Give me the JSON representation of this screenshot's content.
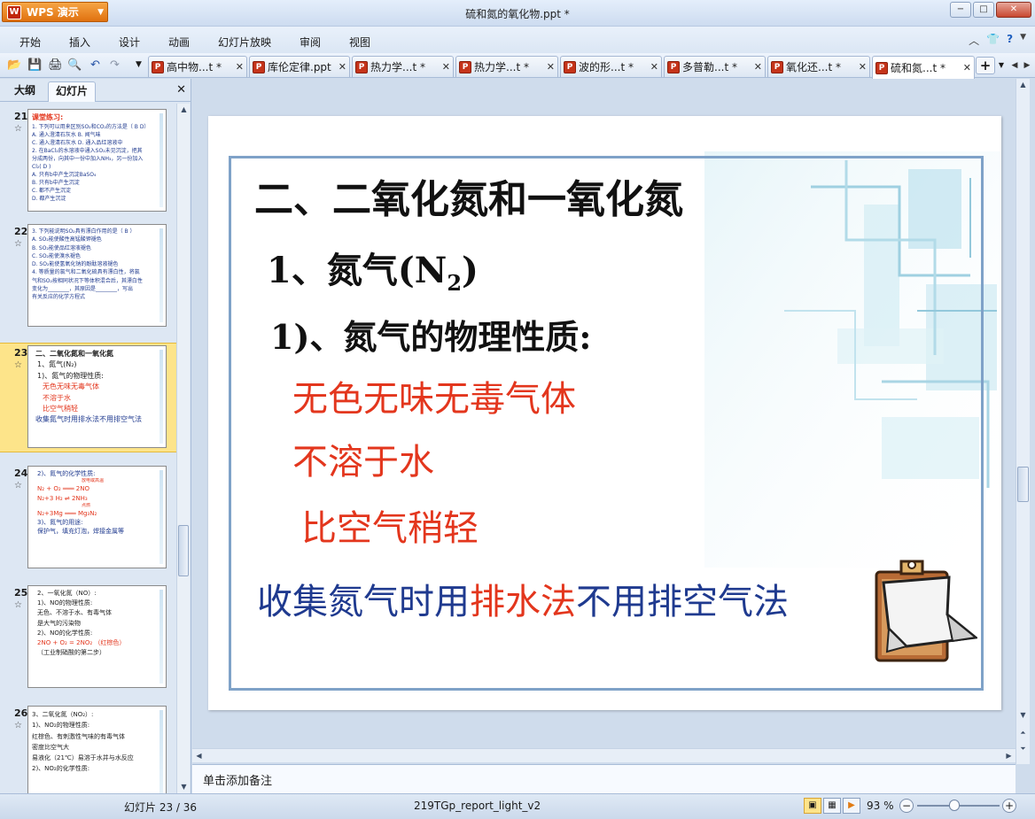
{
  "app": {
    "button_label": "WPS 演示",
    "window_title": "硫和氮的氧化物.ppt *",
    "controls": {
      "minimize": "−",
      "restore": "□",
      "close": "✕"
    }
  },
  "menu": {
    "items": [
      "开始",
      "插入",
      "设计",
      "动画",
      "幻灯片放映",
      "审阅",
      "视图"
    ],
    "right_icons": [
      "chevron-up-icon",
      "shirt-skin-icon",
      "help-icon"
    ]
  },
  "toolbar": {
    "icons": [
      "open-folder-icon",
      "save-icon",
      "print-icon",
      "print-preview-icon",
      "undo-icon",
      "redo-icon",
      "more-icon"
    ]
  },
  "doc_tabs": [
    {
      "label": "高中物...t *",
      "active": false
    },
    {
      "label": "库伦定律.ppt",
      "active": false
    },
    {
      "label": "热力学...t *",
      "active": false
    },
    {
      "label": "热力学...t *",
      "active": false
    },
    {
      "label": "波的形...t *",
      "active": false
    },
    {
      "label": "多普勒...t *",
      "active": false
    },
    {
      "label": "氧化还...t *",
      "active": false
    },
    {
      "label": "硫和氮...t *",
      "active": true
    }
  ],
  "side_pane": {
    "tabs": [
      "大纲",
      "幻灯片"
    ],
    "active_tab": "幻灯片",
    "close": "✕",
    "thumbnails": [
      {
        "number": "21",
        "lines": [
          {
            "text": "课堂练习:",
            "color": "red"
          },
          {
            "text": "1. 下列可以用来区别SO₂和CO₂的方法是（ B D）",
            "color": "blue"
          },
          {
            "text": "A. 通入澄清石灰水  B. 闻气味",
            "color": "blue"
          },
          {
            "text": "C. 通入澄清石灰水  D. 通入品红溶液中",
            "color": "blue"
          },
          {
            "text": "2. 在BaCl₂的水溶液中通入SO₂未见沉淀，把其",
            "color": "blue"
          },
          {
            "text": "分成两份，向其中一份中加入NH₃，另一份加入",
            "color": "blue"
          },
          {
            "text": "Cl₂( D )",
            "color": "blue"
          },
          {
            "text": "A. 只有b中产生沉淀BaSO₄",
            "color": "blue"
          },
          {
            "text": "B. 只有b中产生沉淀",
            "color": "blue"
          },
          {
            "text": "C. 都不产生沉淀",
            "color": "blue"
          },
          {
            "text": "D. 都产生沉淀",
            "color": "blue"
          }
        ]
      },
      {
        "number": "22",
        "lines": [
          {
            "text": "3. 下列能说明SO₂具有漂白作用的是（ B ）",
            "color": "blue"
          },
          {
            "text": "A. SO₂能使酸性高锰酸钾褪色",
            "color": "blue"
          },
          {
            "text": "B. SO₂能使品红溶液褪色",
            "color": "blue"
          },
          {
            "text": "C. SO₂能使溴水褪色",
            "color": "blue"
          },
          {
            "text": "D. SO₂能使氢氧化钠的酚酞溶液褪色",
            "color": "blue"
          },
          {
            "text": "4. 等质量的氯气和二氧化硫具有漂白性，将氯",
            "color": "blue"
          },
          {
            "text": "气和SO₂按相同状况下等体积混合后，其漂白性",
            "color": "blue"
          },
          {
            "text": "变化为________，其原因是________，写出",
            "color": "blue"
          },
          {
            "text": "有关反应的化学方程式",
            "color": "blue"
          }
        ]
      },
      {
        "number": "23",
        "selected": true,
        "lines": [
          {
            "text": "二、二氧化氮和一氧化氮",
            "color": "dark"
          },
          {
            "text": "1、氮气(N₂)",
            "color": "dark"
          },
          {
            "text": "1)、氮气的物理性质:",
            "color": "dark"
          },
          {
            "text": "无色无味无毒气体",
            "color": "red"
          },
          {
            "text": "不溶于水",
            "color": "red"
          },
          {
            "text": "比空气稍轻",
            "color": "red"
          },
          {
            "text": "收集氮气时用排水法不用排空气法",
            "color": "blue"
          }
        ]
      },
      {
        "number": "24",
        "lines": [
          {
            "text": "2)、氮气的化学性质:",
            "color": "blue"
          },
          {
            "text": "放电或高温",
            "color": "red"
          },
          {
            "text": "N₂ + O₂  ═══  2NO",
            "color": "red"
          },
          {
            "text": "N₂+3 H₂  ⇌  2NH₃",
            "color": "red"
          },
          {
            "text": "点燃",
            "color": "red"
          },
          {
            "text": "N₂+3Mg ═══ Mg₃N₂",
            "color": "red"
          },
          {
            "text": "3)、氮气的用途:",
            "color": "blue"
          },
          {
            "text": "保护气，填充灯泡，焊接金属等",
            "color": "blue"
          }
        ]
      },
      {
        "number": "25",
        "lines": [
          {
            "text": "2、一氧化氮（NO）:",
            "color": "dark"
          },
          {
            "text": "1)、NO的物理性质:",
            "color": "dark"
          },
          {
            "text": "无色、不溶于水、有毒气体",
            "color": "dark"
          },
          {
            "text": "是大气的污染物",
            "color": "dark"
          },
          {
            "text": "2)、NO的化学性质:",
            "color": "dark"
          },
          {
            "text": "2NO + O₂ = 2NO₂  （红棕色）",
            "color": "red"
          },
          {
            "text": "（工业制硝酸的第二步）",
            "color": "dark"
          }
        ]
      },
      {
        "number": "26",
        "lines": [
          {
            "text": "3、二氧化氮（NO₂）:",
            "color": "dark"
          },
          {
            "text": "1)、NO₂的物理性质:",
            "color": "dark"
          },
          {
            "text": "红棕色、有刺激性气味的有毒气体",
            "color": "dark"
          },
          {
            "text": "密度比空气大",
            "color": "dark"
          },
          {
            "text": "易液化（21℃）易溶于水并与水反应",
            "color": "dark"
          },
          {
            "text": "2)、NO₂的化学性质:",
            "color": "dark"
          }
        ]
      }
    ]
  },
  "slide": {
    "heading": "二、二氧化氮和一氧化氮",
    "subheading_prefix": "1、氮气(N",
    "subheading_sub": "2",
    "subheading_suffix": ")",
    "section": "1)、氮气的物理性质:",
    "properties": [
      "无色无味无毒气体",
      "不溶于水",
      "比空气稍轻"
    ],
    "note_parts": [
      {
        "text": "收集氮气时用",
        "color": "blue"
      },
      {
        "text": "排水法",
        "color": "red"
      },
      {
        "text": "不用排空气法",
        "color": "blue"
      }
    ]
  },
  "notes_placeholder": "单击添加备注",
  "status": {
    "slide_counter": "幻灯片 23 / 36",
    "theme_name": "219TGp_report_light_v2",
    "zoom": "93 %"
  }
}
